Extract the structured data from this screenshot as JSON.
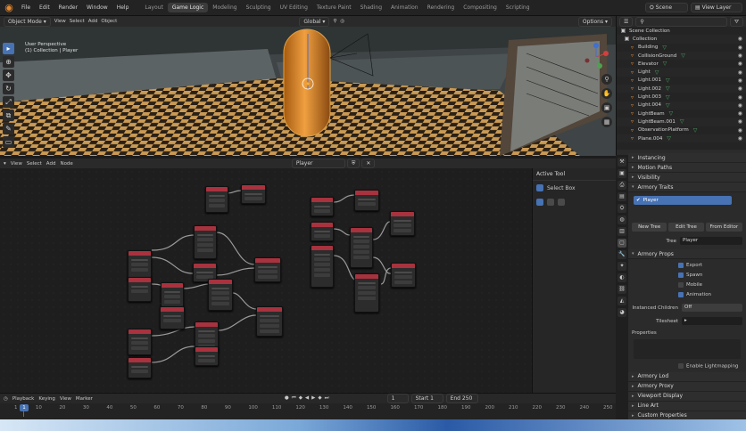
{
  "topbar": {
    "menus": [
      "File",
      "Edit",
      "Render",
      "Window",
      "Help"
    ],
    "workspaces": [
      "Layout",
      "Game Logic",
      "Modeling",
      "Sculpting",
      "UV Editing",
      "Texture Paint",
      "Shading",
      "Animation",
      "Rendering",
      "Compositing",
      "Scripting"
    ],
    "scene": "Scene",
    "view_layer": "View Layer"
  },
  "viewport": {
    "mode": "Object Mode",
    "menus": [
      "View",
      "Select",
      "Add",
      "Object"
    ],
    "transform": "Global",
    "options": "Options",
    "label_line1": "User Perspective",
    "label_line2": "(1) Collection | Player"
  },
  "node_editor": {
    "menus": [
      "View",
      "Select",
      "Add",
      "Node"
    ],
    "tree_name": "Player",
    "active_tool_title": "Active Tool",
    "active_tool": "Select Box"
  },
  "timeline": {
    "menus": [
      "Playback",
      "Keying",
      "View",
      "Marker"
    ],
    "current_frame": "1",
    "start_label": "Start",
    "start": "1",
    "end_label": "End",
    "end": "250",
    "ticks": [
      "1",
      "10",
      "20",
      "30",
      "40",
      "50",
      "60",
      "70",
      "80",
      "90",
      "100",
      "110",
      "120",
      "130",
      "140",
      "150",
      "160",
      "170",
      "180",
      "190",
      "200",
      "210",
      "220",
      "230",
      "240",
      "250"
    ],
    "playhead": "1"
  },
  "outliner": {
    "root": "Scene Collection",
    "collection": "Collection",
    "items": [
      "Building",
      "CollisionGround",
      "Elevator",
      "Light",
      "Light.001",
      "Light.002",
      "Light.003",
      "Light.004",
      "LightBeam",
      "LightBeam.001",
      "ObservationPlatform",
      "Plane.004"
    ]
  },
  "properties": {
    "sections_top": [
      "Instancing",
      "Motion Paths",
      "Visibility",
      "Armory Traits"
    ],
    "trait_name": "Player",
    "btn_new_tree": "New Tree",
    "btn_edit_tree": "Edit Tree",
    "btn_from_editor": "From Editor",
    "tree_label": "Tree",
    "tree_value": "Player",
    "armory_props": "Armory Props",
    "checks": [
      "Export",
      "Spawn",
      "Mobile",
      "Animation"
    ],
    "instanced_children_label": "Instanced Children",
    "instanced_children_value": "Off",
    "tilesheet_label": "Tilesheet",
    "properties_label": "Properties",
    "lightmapping": "Enable Lightmapping",
    "sections_bottom": [
      "Armory Lod",
      "Armory Proxy",
      "Viewport Display",
      "Line Art",
      "Custom Properties"
    ]
  }
}
